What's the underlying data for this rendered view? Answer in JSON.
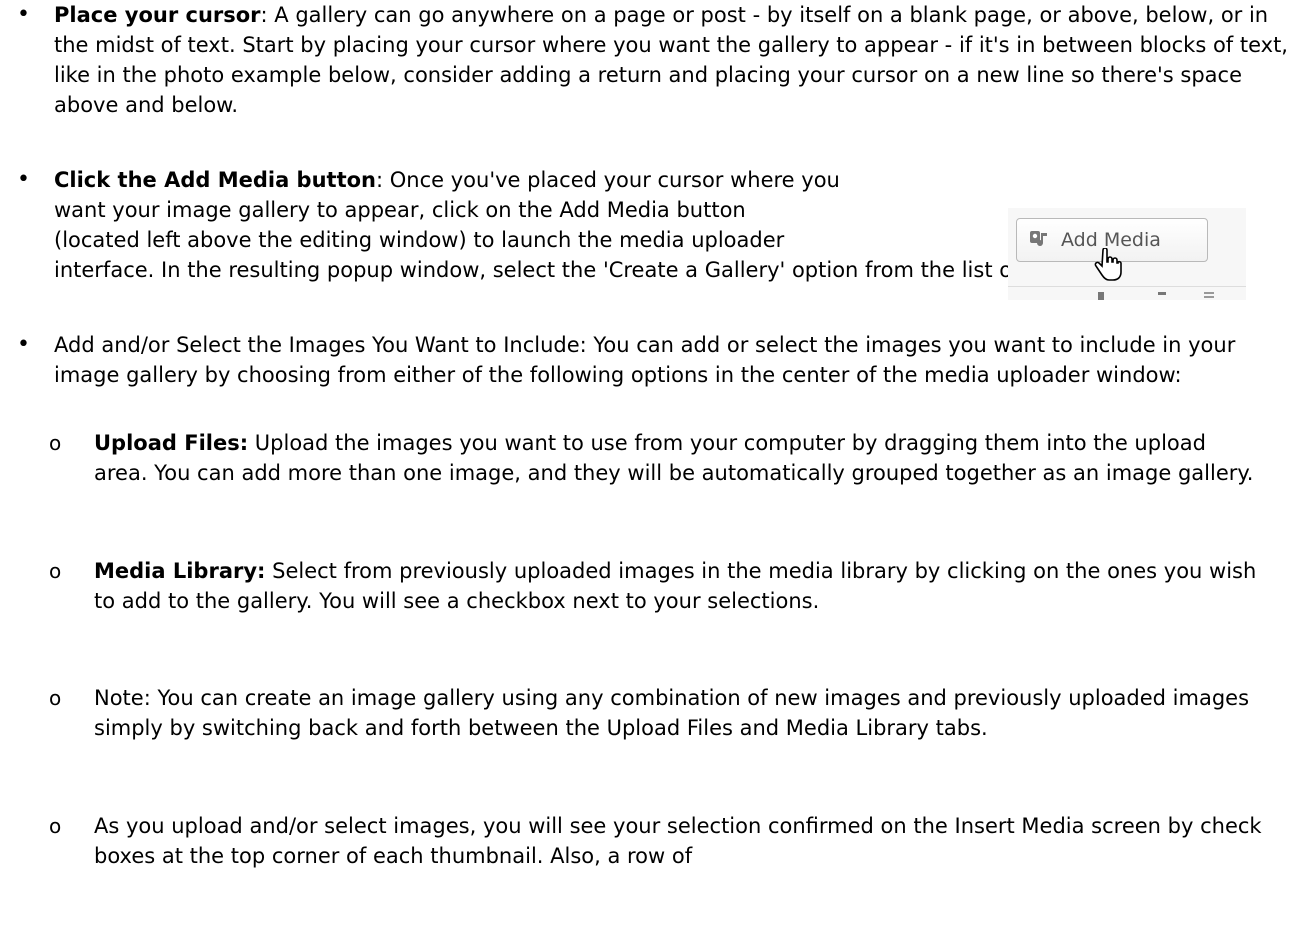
{
  "bullets": [
    {
      "bold": "Place your cursor",
      "text": ": A gallery can go anywhere on a page or post - by itself on a blank page, or above, below, or in the midst of text. Start by placing your cursor where you want the gallery to appear - if it's in between blocks of text, like in the photo example below, consider adding a return and placing your cursor on a new line so there's space above and below."
    },
    {
      "bold": "Click the Add Media button",
      "text_line1": ": Once you've placed your cursor where you",
      "text_line2": "want your image gallery to appear, click on the Add Media button",
      "text_line3": "(located left above the editing window) to launch the media uploader",
      "text_rest": "interface. In the resulting popup window, select the 'Create a Gallery' option from the list of actions on the left."
    },
    {
      "text": "Add and/or Select the Images You Want to Include: You can add or select the images you want to include in your image gallery by choosing from either of the following options in the center of the media uploader window:"
    }
  ],
  "sub_bullets": [
    {
      "bold": "Upload Files:",
      "text": " Upload the images you want to use from your computer by dragging them into the upload area. You can add more than one image, and they will be automatically grouped together as an image gallery."
    },
    {
      "bold": "Media Library:",
      "text": " Select from previously uploaded images in the media library by clicking on the ones you wish to add to the gallery. You will see a checkbox next to your selections."
    },
    {
      "bold": "",
      "text": "Note: You can create an image gallery using any combination of new images and previously uploaded images simply by switching back and forth between the Upload Files and Media Library tabs."
    },
    {
      "bold": "",
      "text": "As you upload and/or select images, you will see your selection confirmed on the Insert Media screen by check boxes at the top corner of each thumbnail. Also, a row of"
    }
  ],
  "bullet_glyph": "•",
  "sub_bullet_glyph": "o",
  "inline_image": {
    "button_label": "Add Media",
    "icon": "media-icon",
    "cursor_icon": "hand-pointer-icon"
  }
}
